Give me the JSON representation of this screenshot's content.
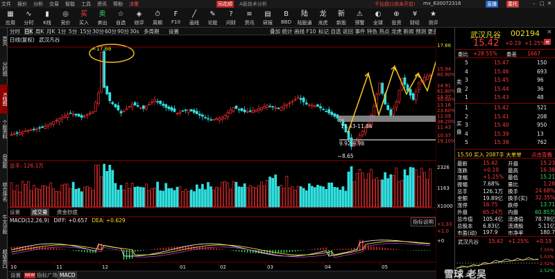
{
  "titlebar": {
    "menus": [
      "文件",
      "报价",
      "分析",
      "交易",
      "智能",
      "工具",
      "资讯",
      "帮助",
      "决策"
    ],
    "app_name": "同花顺",
    "subtitle": "A股技术分析",
    "promo": "千仙盘口尚未开启!",
    "account": "mx_630072316",
    "login": "直播",
    "mode": "委托"
  },
  "toolbar": {
    "buttons": [
      "应用",
      "分时",
      "K线",
      "竞价",
      "买入",
      "卖出",
      "自选",
      "综评",
      "周期",
      "F10",
      "画线",
      "论股",
      "问财",
      "资讯",
      "研报",
      "BBD",
      "陆股通",
      "龙虎",
      "新股",
      "预警",
      "全球",
      "投资",
      "财经",
      "测评"
    ]
  },
  "left_strip": [
    "首页",
    "分时图",
    "K线图",
    "个股资料",
    "自选股",
    "综合排名",
    "牛叉诊股",
    "超级盘口"
  ],
  "period_tabs": [
    "分时",
    "日K",
    "周K",
    "月K",
    "1分",
    "5分",
    "15分",
    "30分",
    "60分",
    "90分",
    "30s",
    "多周期",
    "设置"
  ],
  "period_active": "日K",
  "indicator_tabs": [
    "叠加",
    "统计",
    "画线",
    "F10",
    "标记",
    "自选",
    "返回",
    "事件",
    "特色",
    "热点",
    "龙虎",
    "新闻",
    "预测",
    "更多"
  ],
  "stock": {
    "code": "002194",
    "name": "武汉凡谷",
    "chart_label": "日线(复权)",
    "price": "15.42",
    "change": "+0.19",
    "pct": "+1.25%",
    "tag": "委比",
    "weibi": "+28.55%",
    "weicha": "1667"
  },
  "orderbook": {
    "sell": [
      {
        "lvl": "5",
        "price": "15.47",
        "vol": "150"
      },
      {
        "lvl": "4",
        "price": "15.46",
        "vol": "693"
      },
      {
        "lvl": "3",
        "price": "15.45",
        "vol": "96"
      },
      {
        "lvl": "2",
        "price": "15.44",
        "vol": "36"
      },
      {
        "lvl": "1",
        "price": "15.43",
        "vol": "48"
      }
    ],
    "buy": [
      {
        "lvl": "1",
        "price": "15.42",
        "vol": "521"
      },
      {
        "lvl": "2",
        "price": "15.41",
        "vol": "208"
      },
      {
        "lvl": "3",
        "price": "15.40",
        "vol": "950"
      },
      {
        "lvl": "4",
        "price": "15.39",
        "vol": "13"
      },
      {
        "lvl": "5",
        "price": "15.38",
        "vol": "762"
      }
    ],
    "trade_line": "15.50 买入 2087手 大单单",
    "trade_right": "点击查看"
  },
  "quote": [
    [
      "最新",
      "15.42",
      "开盘",
      "15.23"
    ],
    [
      "涨跌",
      "+0.19",
      "最高",
      "16.38"
    ],
    [
      "涨幅",
      "+1.25%",
      "最低",
      "15.21"
    ],
    [
      "振幅",
      "7.68%",
      "量比",
      "1.28"
    ],
    [
      "总手",
      "126.1万",
      "换手",
      "24.68%"
    ],
    [
      "金额",
      "19.89亿",
      "换手(实)",
      "32.35%"
    ],
    [
      "涨停",
      "16.75",
      "跌停",
      "13.71"
    ],
    [
      "外盘",
      "65.24万",
      "内盘",
      "60.85万"
    ],
    [
      "总市值",
      "105.4亿",
      "流通值",
      "78.78亿"
    ],
    [
      "总股本",
      "6.83亿",
      "流通股",
      "5.11亿"
    ],
    [
      "市盈(动)",
      "197.9",
      "市净率",
      "180.7"
    ]
  ],
  "mini": {
    "name": "武汉凡谷",
    "price": "15.42",
    "pct": "+1.25%",
    "chg": "+0.19",
    "r1": "7.55%",
    "r2": "5.03%",
    "r3": "2.52%",
    "r4": "2.52%",
    "low": "15.23"
  },
  "main_chart": {
    "high_label": "17.66",
    "right_high": "17.66",
    "annots": [
      "11.43-11.86",
      "9.92-9.98",
      "8.65"
    ],
    "scale_prices": [
      "15.94",
      "14.91",
      "14.37",
      "13.16",
      "12.09",
      "11.43",
      "10.37"
    ],
    "scale_pcts": [
      "80.90%",
      "61.80%",
      "50.00%",
      "38.20%",
      "23.60%",
      "19.10%"
    ]
  },
  "volume": {
    "label": "总手: 126.1万",
    "max": "2326",
    "mid": "1163",
    "unit": "X1000"
  },
  "vol_tabs": [
    "设置",
    "成交量",
    "资金抄底"
  ],
  "macd": {
    "label": "MACD(12,26,9)",
    "diff": "DIFF: +0.657",
    "dea": "DEA: +0.629",
    "btn": "指标说明",
    "s1": "+1.33",
    "s2": "+1.0",
    "s3": "+0"
  },
  "xaxis": [
    "10",
    "11",
    "12",
    "01",
    "02",
    "03",
    "04",
    "05"
  ],
  "bottom": {
    "tabs": [
      "设置",
      "指标广场",
      "MACD"
    ]
  },
  "watermark": "雪球 老吴"
}
